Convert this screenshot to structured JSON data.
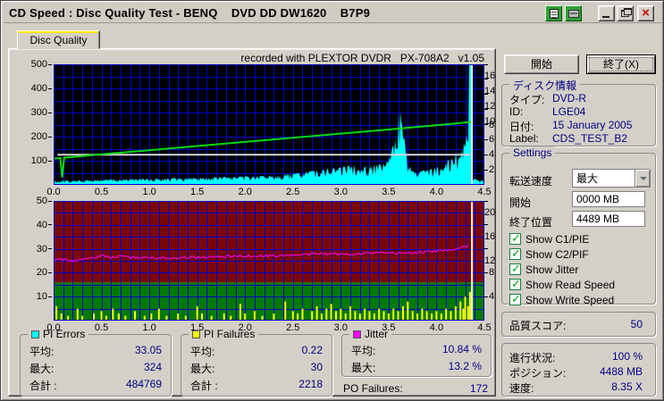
{
  "window": {
    "title": "CD Speed : Disc Quality Test - BENQ    DVD DD DW1620    B7P9"
  },
  "tab": {
    "label": "Disc Quality"
  },
  "charts": {
    "annotation": "recorded with PLEXTOR DVDR   PX-708A2   v1.05"
  },
  "chart_data": [
    {
      "type": "area",
      "title": "PI Errors / speed scan",
      "x_range": [
        0,
        4.5
      ],
      "x_ticks": [
        0.0,
        0.5,
        1.0,
        1.5,
        2.0,
        2.5,
        3.0,
        3.5,
        4.0,
        4.5
      ],
      "left_axis": {
        "range": [
          0,
          500
        ],
        "ticks": [
          100,
          200,
          300,
          400,
          500
        ],
        "grid_step": 50
      },
      "right_axis": {
        "range": [
          0,
          16
        ],
        "ticks": [
          2,
          4,
          6,
          8,
          10,
          12,
          14,
          16
        ]
      },
      "background": "#000000",
      "grid_color": "#0000c8",
      "grid_x_step": 0.1,
      "end_marker_x": 4.37,
      "legend_position": "none",
      "series": [
        {
          "name": "PI Errors",
          "type": "area",
          "color": "#00ffff",
          "axis": "left",
          "noise": 0.55,
          "points": [
            [
              0,
              16
            ],
            [
              0.1,
              18
            ],
            [
              0.2,
              17
            ],
            [
              0.3,
              20
            ],
            [
              0.4,
              19
            ],
            [
              0.5,
              21
            ],
            [
              0.6,
              23
            ],
            [
              0.7,
              21
            ],
            [
              0.8,
              24
            ],
            [
              0.9,
              26
            ],
            [
              1.0,
              24
            ],
            [
              1.1,
              27
            ],
            [
              1.2,
              29
            ],
            [
              1.3,
              27
            ],
            [
              1.4,
              29
            ],
            [
              1.5,
              31
            ],
            [
              1.6,
              29
            ],
            [
              1.7,
              32
            ],
            [
              1.8,
              34
            ],
            [
              1.9,
              32
            ],
            [
              2.0,
              36
            ],
            [
              2.1,
              35
            ],
            [
              2.2,
              38
            ],
            [
              2.3,
              41
            ],
            [
              2.4,
              44
            ],
            [
              2.5,
              48
            ],
            [
              2.6,
              53
            ],
            [
              2.7,
              58
            ],
            [
              2.75,
              68
            ],
            [
              2.8,
              62
            ],
            [
              2.9,
              68
            ],
            [
              3.0,
              74
            ],
            [
              3.05,
              82
            ],
            [
              3.1,
              78
            ],
            [
              3.15,
              88
            ],
            [
              3.2,
              74
            ],
            [
              3.3,
              78
            ],
            [
              3.35,
              88
            ],
            [
              3.4,
              84
            ],
            [
              3.45,
              92
            ],
            [
              3.5,
              105
            ],
            [
              3.55,
              170
            ],
            [
              3.58,
              255
            ],
            [
              3.61,
              324
            ],
            [
              3.63,
              300
            ],
            [
              3.66,
              200
            ],
            [
              3.7,
              95
            ],
            [
              3.75,
              58
            ],
            [
              3.8,
              52
            ],
            [
              3.85,
              58
            ],
            [
              3.9,
              62
            ],
            [
              3.95,
              68
            ],
            [
              4.0,
              72
            ],
            [
              4.05,
              82
            ],
            [
              4.1,
              98
            ],
            [
              4.15,
              118
            ],
            [
              4.18,
              90
            ],
            [
              4.2,
              150
            ],
            [
              4.22,
              110
            ],
            [
              4.24,
              185
            ],
            [
              4.26,
              120
            ],
            [
              4.28,
              205
            ],
            [
              4.3,
              150
            ],
            [
              4.32,
              250
            ],
            [
              4.33,
              290
            ],
            [
              4.34,
              500
            ],
            [
              4.37,
              500
            ],
            [
              4.378,
              30
            ],
            [
              4.42,
              22
            ],
            [
              4.5,
              16
            ]
          ]
        },
        {
          "name": "Write Speed",
          "type": "line",
          "color": "#d6d6d6",
          "axis": "right",
          "width": 2,
          "points": [
            [
              0.04,
              4
            ],
            [
              4.35,
              4
            ]
          ]
        },
        {
          "name": "Read Speed",
          "type": "line",
          "color": "#00dc00",
          "axis": "right",
          "width": 2,
          "points": [
            [
              0,
              3.5
            ],
            [
              0.07,
              3.56
            ],
            [
              0.09,
              1.0
            ],
            [
              0.11,
              3.6
            ],
            [
              0.5,
              4.05
            ],
            [
              1.0,
              4.6
            ],
            [
              1.5,
              5.15
            ],
            [
              2.0,
              5.7
            ],
            [
              2.5,
              6.25
            ],
            [
              3.0,
              6.8
            ],
            [
              3.5,
              7.35
            ],
            [
              4.0,
              7.9
            ],
            [
              4.37,
              8.35
            ]
          ]
        }
      ]
    },
    {
      "type": "bar",
      "title": "PI Failures / Jitter scan",
      "x_range": [
        0,
        4.5
      ],
      "x_ticks": [
        0.0,
        0.5,
        1.0,
        1.5,
        2.0,
        2.5,
        3.0,
        3.5,
        4.0,
        4.5
      ],
      "left_axis": {
        "range": [
          0,
          50
        ],
        "ticks": [
          10,
          20,
          30,
          40,
          50
        ],
        "grid_step": 5
      },
      "right_axis": {
        "range": [
          0,
          20
        ],
        "ticks": [
          4,
          8,
          12,
          16,
          20
        ]
      },
      "bg_zones": [
        {
          "from": 0,
          "to": 16,
          "color": "#007a00"
        },
        {
          "from": 16,
          "to": 50,
          "color": "#7a0606"
        }
      ],
      "grid_color": "#0000c8",
      "grid_x_step": 0.1,
      "end_marker_x": 4.37,
      "legend_position": "none",
      "series": [
        {
          "name": "PI Failures",
          "type": "bars",
          "color": "#ffff00",
          "axis": "left",
          "points": [
            [
              0.03,
              6
            ],
            [
              0.08,
              3
            ],
            [
              0.15,
              2
            ],
            [
              0.25,
              5
            ],
            [
              0.3,
              2
            ],
            [
              0.42,
              3
            ],
            [
              0.5,
              4
            ],
            [
              0.55,
              2
            ],
            [
              0.62,
              5
            ],
            [
              0.68,
              3
            ],
            [
              0.75,
              2
            ],
            [
              0.85,
              4
            ],
            [
              0.95,
              2
            ],
            [
              1.02,
              3
            ],
            [
              1.1,
              5
            ],
            [
              1.18,
              2
            ],
            [
              1.3,
              3
            ],
            [
              1.38,
              2
            ],
            [
              1.5,
              6
            ],
            [
              1.55,
              3
            ],
            [
              1.65,
              2
            ],
            [
              1.78,
              3
            ],
            [
              1.85,
              2
            ],
            [
              1.95,
              7
            ],
            [
              2.0,
              3
            ],
            [
              2.1,
              4
            ],
            [
              2.18,
              2
            ],
            [
              2.3,
              3
            ],
            [
              2.42,
              8
            ],
            [
              2.5,
              4
            ],
            [
              2.55,
              3
            ],
            [
              2.6,
              5
            ],
            [
              2.7,
              4
            ],
            [
              2.75,
              6
            ],
            [
              2.8,
              3
            ],
            [
              2.85,
              5
            ],
            [
              2.9,
              7
            ],
            [
              2.95,
              4
            ],
            [
              3.0,
              5
            ],
            [
              3.05,
              3
            ],
            [
              3.1,
              6
            ],
            [
              3.15,
              4
            ],
            [
              3.2,
              3
            ],
            [
              3.25,
              5
            ],
            [
              3.3,
              4
            ],
            [
              3.35,
              3
            ],
            [
              3.4,
              5
            ],
            [
              3.45,
              4
            ],
            [
              3.5,
              3
            ],
            [
              3.55,
              5
            ],
            [
              3.6,
              4
            ],
            [
              3.65,
              6
            ],
            [
              3.7,
              8
            ],
            [
              3.75,
              4
            ],
            [
              3.8,
              3
            ],
            [
              3.85,
              5
            ],
            [
              3.9,
              4
            ],
            [
              3.95,
              3
            ],
            [
              4.0,
              4
            ],
            [
              4.05,
              3
            ],
            [
              4.1,
              5
            ],
            [
              4.15,
              4
            ],
            [
              4.2,
              6
            ],
            [
              4.25,
              8
            ],
            [
              4.28,
              5
            ],
            [
              4.3,
              10
            ],
            [
              4.33,
              6
            ],
            [
              4.35,
              12
            ],
            [
              4.37,
              48
            ]
          ]
        },
        {
          "name": "Jitter",
          "type": "line",
          "color": "#ff00ff",
          "axis": "right",
          "width": 1,
          "noise_abs": 0.22,
          "points": [
            [
              0,
              10.3
            ],
            [
              0.1,
              10.2
            ],
            [
              0.2,
              9.9
            ],
            [
              0.3,
              10.3
            ],
            [
              0.4,
              10.5
            ],
            [
              0.5,
              10.8
            ],
            [
              0.6,
              10.6
            ],
            [
              0.7,
              10.7
            ],
            [
              0.8,
              10.5
            ],
            [
              0.9,
              10.6
            ],
            [
              1.0,
              10.5
            ],
            [
              1.2,
              10.5
            ],
            [
              1.4,
              10.6
            ],
            [
              1.6,
              10.6
            ],
            [
              1.8,
              10.7
            ],
            [
              2.0,
              10.8
            ],
            [
              2.2,
              10.8
            ],
            [
              2.4,
              10.9
            ],
            [
              2.6,
              11.0
            ],
            [
              2.8,
              11.2
            ],
            [
              3.0,
              11.1
            ],
            [
              3.2,
              11.2
            ],
            [
              3.4,
              11.3
            ],
            [
              3.6,
              11.2
            ],
            [
              3.8,
              11.4
            ],
            [
              4.0,
              11.6
            ],
            [
              4.1,
              11.8
            ],
            [
              4.2,
              12.0
            ],
            [
              4.3,
              12.4
            ],
            [
              4.35,
              12.7
            ]
          ]
        }
      ]
    }
  ],
  "stats": {
    "boxes": [
      {
        "name": "PI Errors",
        "swatch": "#00ffff",
        "rows": [
          {
            "label": "平均:",
            "value": "33.05"
          },
          {
            "label": "最大:",
            "value": "324"
          },
          {
            "label": "合計 :",
            "value": "484769"
          }
        ]
      },
      {
        "name": "PI Failures",
        "swatch": "#ffff00",
        "rows": [
          {
            "label": "平均:",
            "value": "0.22"
          },
          {
            "label": "最大:",
            "value": "30"
          },
          {
            "label": "合計 :",
            "value": "2218"
          }
        ]
      },
      {
        "name": "Jitter",
        "swatch": "#ff00ff",
        "rows": [
          {
            "label": "平均:",
            "value": "10.84 %"
          },
          {
            "label": "最大:",
            "value": "13.2 %"
          }
        ]
      }
    ],
    "po_failures": {
      "label": "PO Failures:",
      "value": "172"
    }
  },
  "panel": {
    "start_button": "開始",
    "exit_button": "終了(X)",
    "disc_info": {
      "title": "ディスク情報",
      "rows": [
        {
          "label": "タイプ:",
          "value": "DVD-R"
        },
        {
          "label": "ID:",
          "value": "LGE04"
        },
        {
          "label": "日付:",
          "value": "15 January 2005"
        },
        {
          "label": "Label:",
          "value": "CDS_TEST_B2"
        }
      ]
    },
    "settings": {
      "title": "Settings",
      "transfer_label": "転送速度",
      "transfer_value": "最大",
      "start_label": "開始",
      "start_value": "0000 MB",
      "end_label": "終了位置",
      "end_value": "4489 MB",
      "checkboxes": [
        {
          "label": "Show C1/PIE",
          "checked": true
        },
        {
          "label": "Show C2/PIF",
          "checked": true
        },
        {
          "label": "Show Jitter",
          "checked": true
        },
        {
          "label": "Show Read Speed",
          "checked": true
        },
        {
          "label": "Show Write Speed",
          "checked": true
        }
      ]
    },
    "quality": {
      "label": "品質スコア:",
      "value": "50"
    },
    "progress": {
      "rows": [
        {
          "label": "進行状況:",
          "value": "100 %"
        },
        {
          "label": "ポジション:",
          "value": "4488 MB"
        },
        {
          "label": "速度:",
          "value": "8.35 X"
        }
      ]
    }
  }
}
